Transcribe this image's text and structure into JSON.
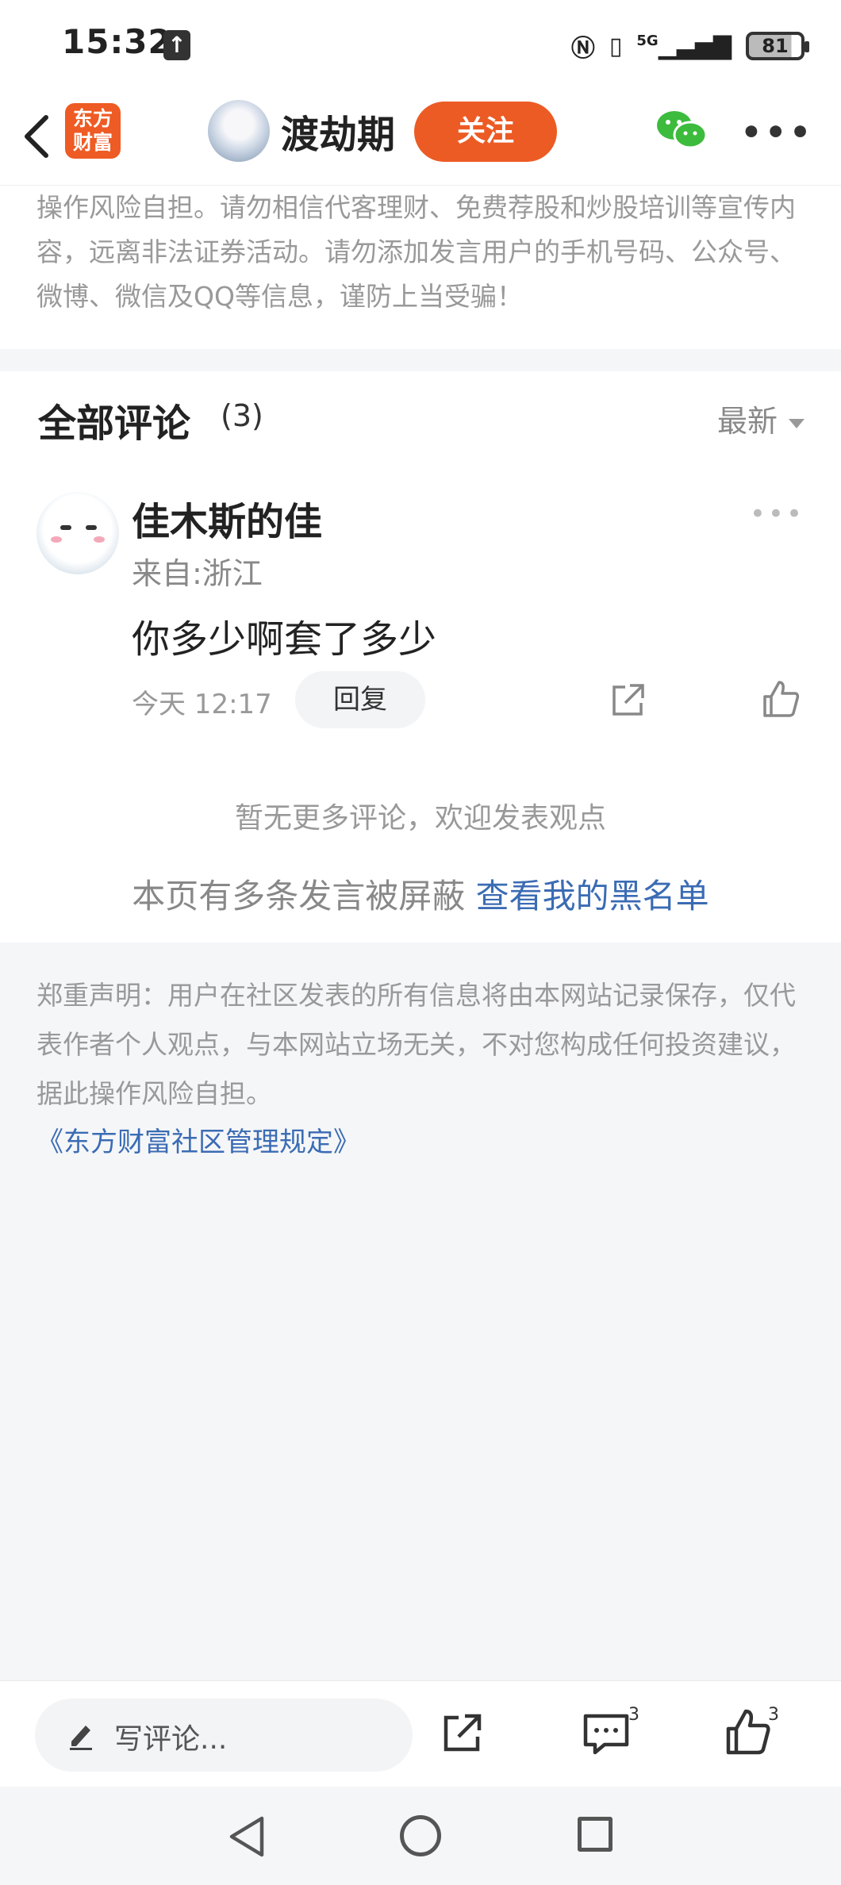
{
  "status_bar": {
    "time": "15:32",
    "network": "5G",
    "battery": "81"
  },
  "header": {
    "logo_text": "东方财富",
    "author_name": "渡劫期",
    "follow_label": "关注"
  },
  "disclaimer_top": {
    "text": "操作风险自担。请勿相信代客理财、免费荐股和炒股培训等宣传内容，远离非法证券活动。请勿添加发言用户的手机号码、公众号、微博、微信及QQ等信息，谨防上当受骗！"
  },
  "comments": {
    "title": "全部评论",
    "count": "(3)",
    "sort_label": "最新",
    "items": [
      {
        "user": "佳木斯的佳",
        "from": "来自:浙江",
        "text": "你多少啊套了多少",
        "time": "今天 12:17",
        "reply_label": "回复"
      }
    ],
    "no_more": "暂无更多评论，欢迎发表观点",
    "blocked_text": "本页有多条发言被屏蔽",
    "blocked_link": "查看我的黑名单"
  },
  "disclaimer_bottom": {
    "text": "郑重声明：用户在社区发表的所有信息将由本网站记录保存，仅代表作者个人观点，与本网站立场无关，不对您构成任何投资建议，据此操作风险自担。",
    "rules_link": "《东方财富社区管理规定》"
  },
  "bottom_bar": {
    "input_placeholder": "写评论...",
    "comment_count": "3",
    "like_count": "3"
  }
}
